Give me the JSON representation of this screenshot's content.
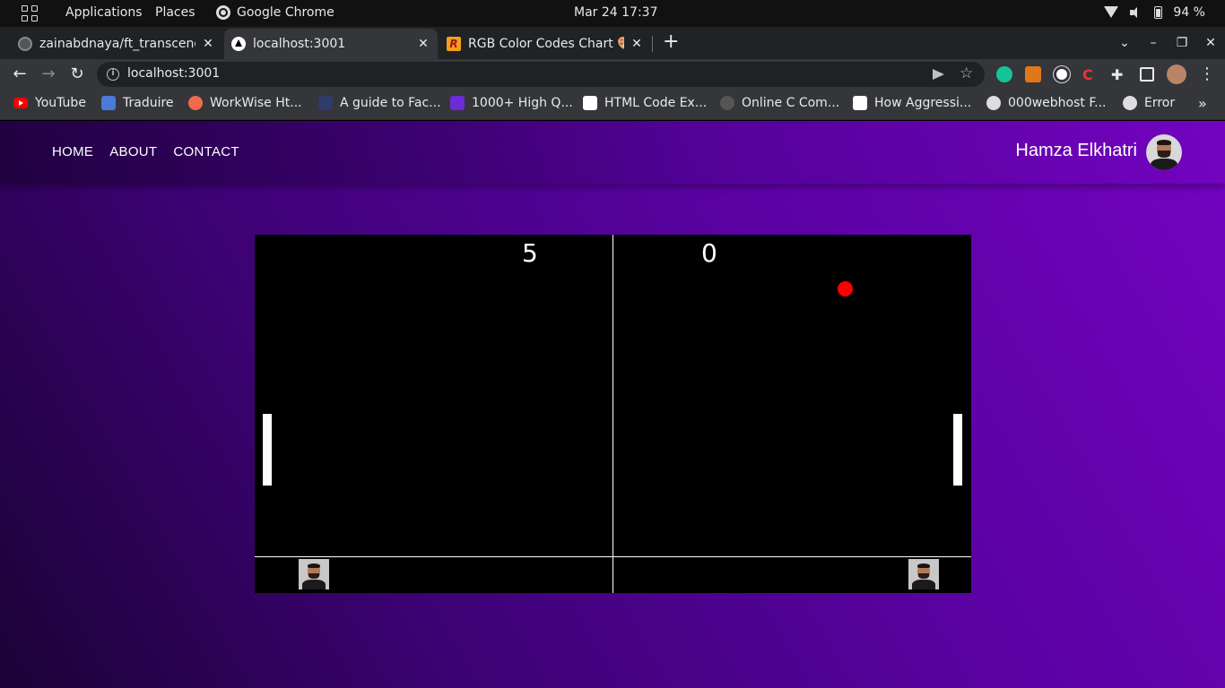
{
  "topbar": {
    "applications": "Applications",
    "places": "Places",
    "active_app": "Google Chrome",
    "datetime": "Mar 24  17:37",
    "battery": "94 %"
  },
  "tabs": [
    {
      "title": "zainabdnaya/ft_transcendence",
      "favicon": "github-icon",
      "active": false
    },
    {
      "title": "localhost:3001",
      "favicon": "triangle-icon",
      "active": true
    },
    {
      "title": "RGB Color Codes Chart 🎨",
      "favicon": "r-logo-icon",
      "active": false
    }
  ],
  "toolbar": {
    "url": "localhost:3001"
  },
  "bookmarks": [
    {
      "label": "YouTube"
    },
    {
      "label": "Traduire"
    },
    {
      "label": "WorkWise Ht..."
    },
    {
      "label": "A guide to Fac..."
    },
    {
      "label": "1000+ High Q..."
    },
    {
      "label": "HTML Code Ex..."
    },
    {
      "label": "Online C Com..."
    },
    {
      "label": "How Aggressi..."
    },
    {
      "label": "000webhost F..."
    },
    {
      "label": "Error"
    }
  ],
  "site": {
    "nav": [
      "HOME",
      "ABOUT",
      "CONTACT"
    ],
    "user_name": "Hamza Elkhatri"
  },
  "game": {
    "score_left": "5",
    "score_right": "0",
    "ball_color": "#ff0000",
    "paddle_color": "#ffffff",
    "board_color": "#000000"
  },
  "colors": {
    "page_gradient_start": "#1b0236",
    "page_gradient_end": "#7303c0",
    "chrome_toolbar": "#35363a",
    "chrome_tabstrip": "#1f2326"
  }
}
